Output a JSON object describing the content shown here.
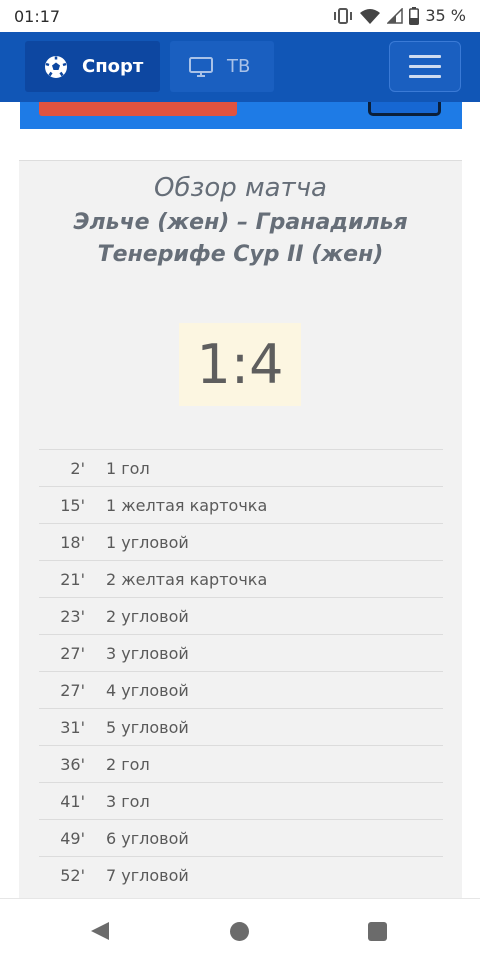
{
  "status_bar": {
    "time": "01:17",
    "battery": "35 %",
    "icons": [
      "vibrate-icon",
      "wifi-icon",
      "signal-icon",
      "battery-icon"
    ]
  },
  "header": {
    "sport_label": "Спорт",
    "tv_label": "ТВ",
    "accent_color": "#1156b6"
  },
  "match": {
    "title": "Обзор матча",
    "teams": "Эльче (жен) – Гранадилья Тенерифе Сур II (жен)",
    "score": "1:4",
    "events": [
      {
        "minute": "2'",
        "text": "1 гол"
      },
      {
        "minute": "15'",
        "text": "1 желтая карточка"
      },
      {
        "minute": "18'",
        "text": "1 угловой"
      },
      {
        "minute": "21'",
        "text": "2 желтая карточка"
      },
      {
        "minute": "23'",
        "text": "2 угловой"
      },
      {
        "minute": "27'",
        "text": "3 угловой"
      },
      {
        "minute": "27'",
        "text": "4 угловой"
      },
      {
        "minute": "31'",
        "text": "5 угловой"
      },
      {
        "minute": "36'",
        "text": "2 гол"
      },
      {
        "minute": "41'",
        "text": "3 гол"
      },
      {
        "minute": "49'",
        "text": "6 угловой"
      },
      {
        "minute": "52'",
        "text": "7 угловой"
      }
    ]
  }
}
